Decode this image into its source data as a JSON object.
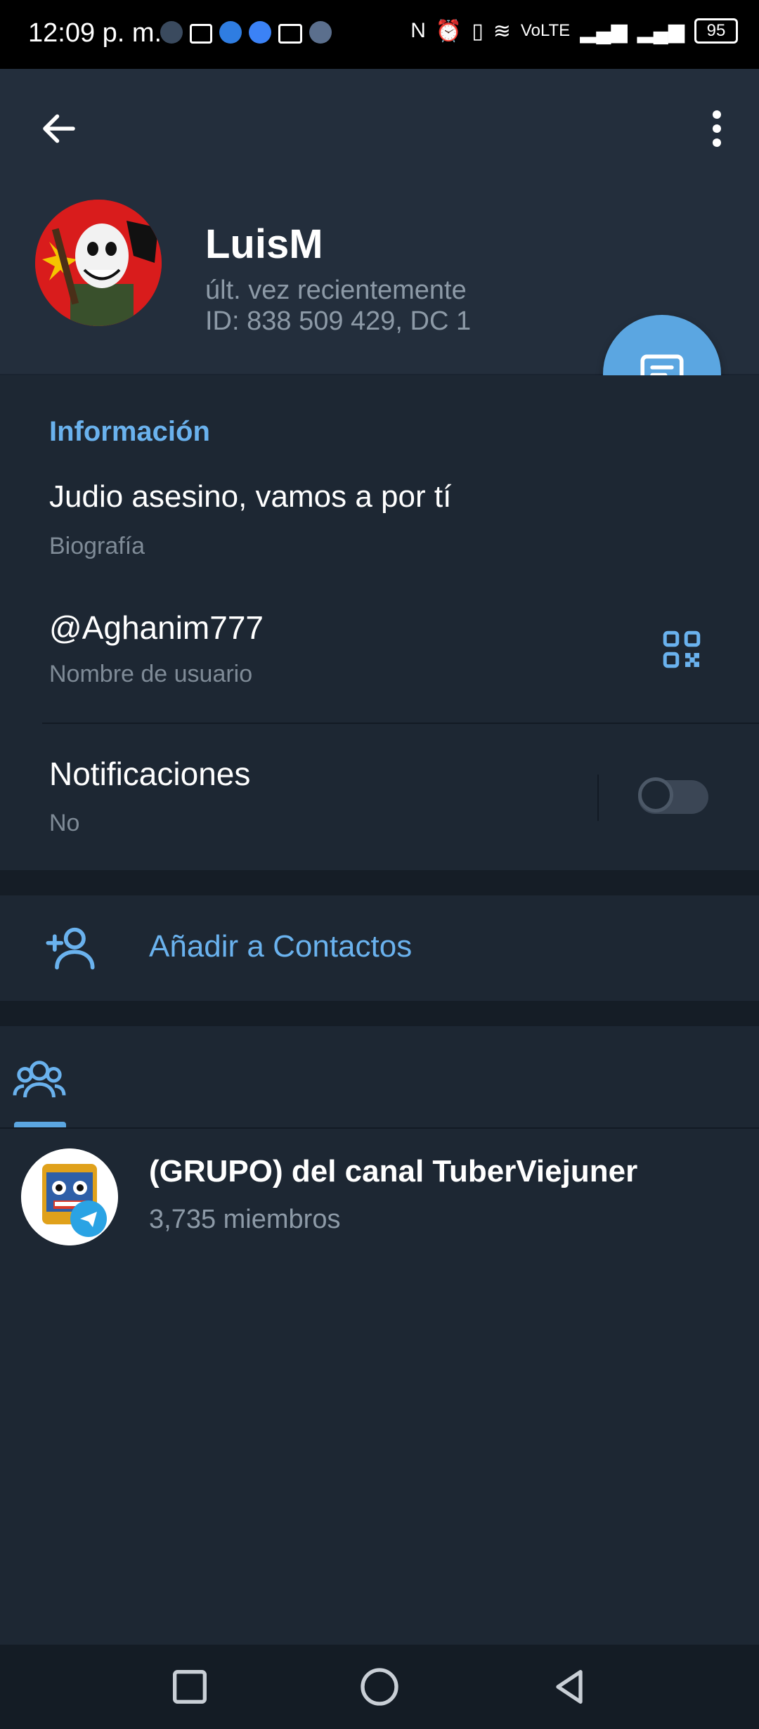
{
  "status_bar": {
    "time": "12:09 p. m.",
    "network": "VoLTE",
    "battery": "95"
  },
  "header": {
    "name": "LuisM",
    "last_seen": "últ. vez recientemente",
    "user_id": "ID: 838 509 429, DC 1"
  },
  "info": {
    "section_title": "Información",
    "bio": "Judio asesino, vamos a por tí",
    "bio_label": "Biografía",
    "username": "@Aghanim777",
    "username_label": "Nombre de usuario",
    "notifications_title": "Notificaciones",
    "notifications_value": "No",
    "notifications_enabled": false
  },
  "actions": {
    "add_contact": "Añadir a Contactos"
  },
  "groups": {
    "items": [
      {
        "name": "(GRUPO) del canal TuberViejuner",
        "members": "3,735 miembros"
      }
    ]
  },
  "colors": {
    "background": "#1d2733",
    "header": "#232e3c",
    "accent": "#6ab2ee",
    "fab": "#5ba6e1",
    "secondary_text": "#8d9aa7"
  },
  "icons": {
    "back": "arrow-left-icon",
    "menu": "more-vertical-icon",
    "fab": "message-icon",
    "qr": "qr-code-icon",
    "add_contact": "add-user-icon",
    "groups_tab": "groups-icon"
  }
}
